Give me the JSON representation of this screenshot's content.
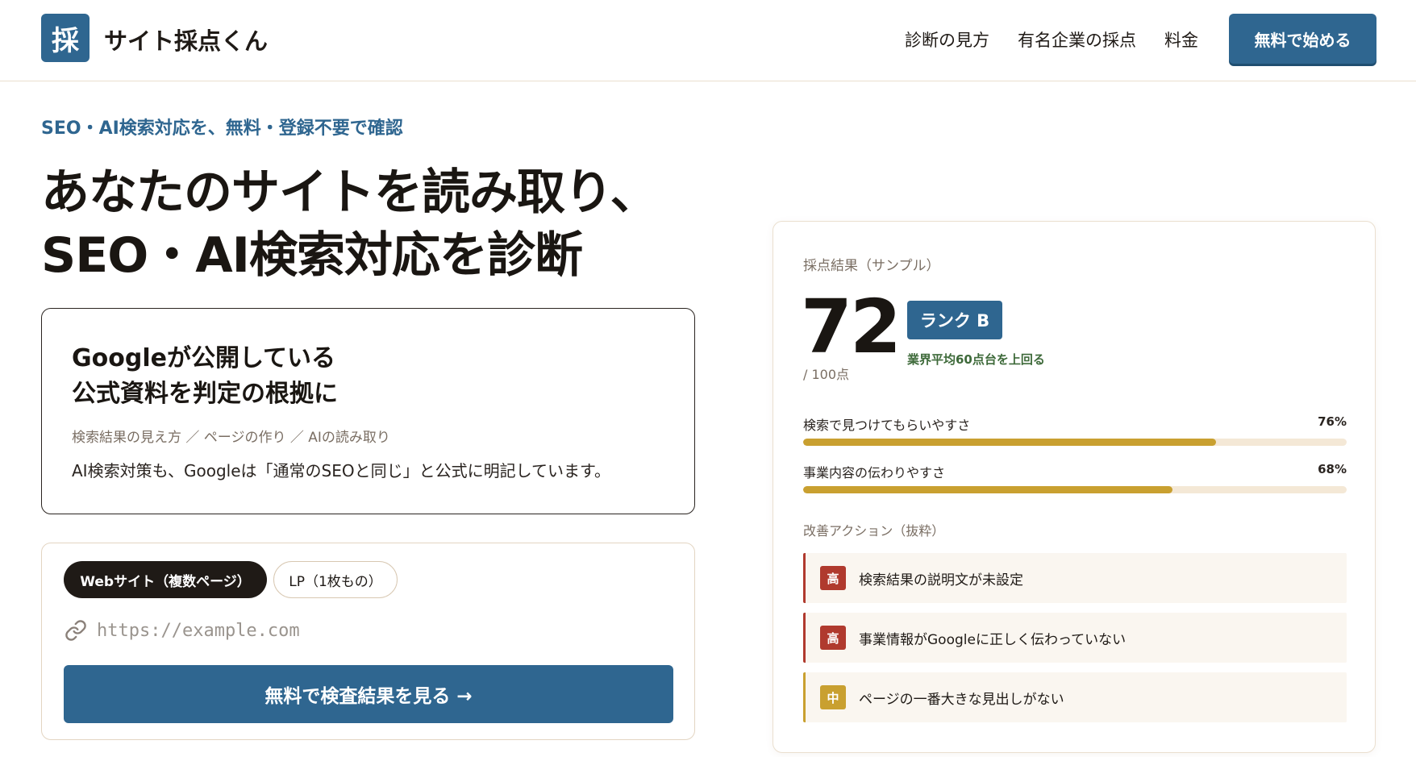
{
  "header": {
    "logo_mark": "採",
    "logo_text": "サイト採点くん",
    "nav": [
      "診断の見方",
      "有名企業の採点",
      "料金"
    ],
    "cta": "無料で始める"
  },
  "hero": {
    "eyebrow": "SEO・AI検索対応を、無料・登録不要で確認",
    "headline_lines": [
      "あなたのサイトを読み取り、",
      "SEO・AI検索対応を診断"
    ]
  },
  "info_card": {
    "title_lines": [
      "Googleが公開している",
      "公式資料を判定の根拠に"
    ],
    "tags": "検索結果の見え方 ／ ページの作り ／ AIの読み取り",
    "body": "AI検索対策も、Googleは「通常のSEOと同じ」と公式に明記しています。"
  },
  "form": {
    "tabs": [
      "Webサイト（複数ページ）",
      "LP（1枚もの）"
    ],
    "active_tab": "Webサイト（複数ページ）",
    "url_placeholder": "https://example.com",
    "url_value": "",
    "submit_label": "無料で検査結果を見る →",
    "link_icon": "link-icon"
  },
  "result": {
    "label": "採点結果（サンプル）",
    "score": "72",
    "score_total": "/ 100点",
    "rank": "ランク B",
    "rank_note": "業界平均60点台を上回る",
    "metrics": [
      {
        "label": "検索で見つけてもらいやすさ",
        "value_text": "76%",
        "value": 76
      },
      {
        "label": "事業内容の伝わりやすさ",
        "value_text": "68%",
        "value": 68
      }
    ],
    "actions_label": "改善アクション（抜粋）",
    "actions": [
      {
        "level": "高",
        "text": "検索結果の説明文が未設定"
      },
      {
        "level": "高",
        "text": "事業情報がGoogleに正しく伝わっていない"
      },
      {
        "level": "中",
        "text": "ページの一番大きな見出しがない"
      }
    ]
  },
  "colors": {
    "brand": "#2f6690",
    "dark": "#1f1a16",
    "bar": "#c9a030",
    "priority_high": "#b03a2e",
    "priority_mid": "#c9a030"
  }
}
